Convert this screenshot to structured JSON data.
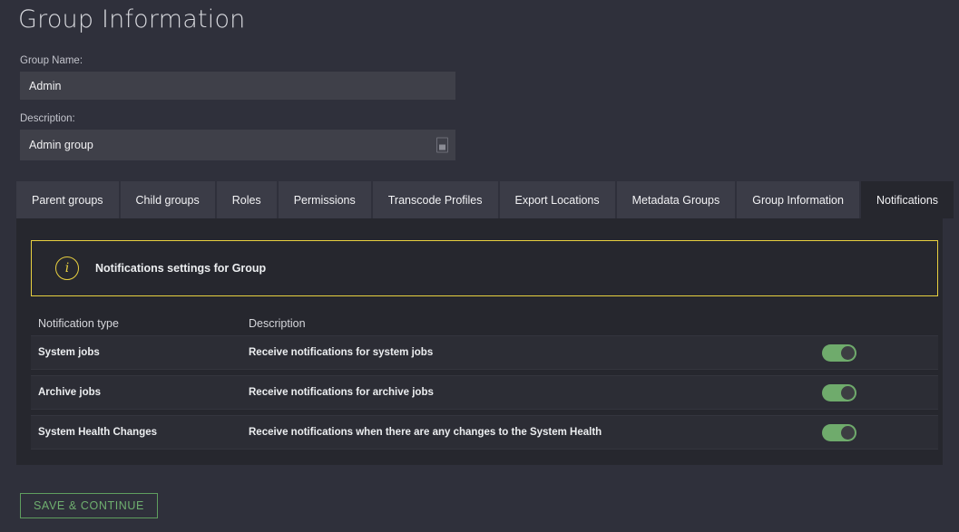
{
  "page": {
    "title": "Group Information"
  },
  "form": {
    "group_name": {
      "label": "Group Name:",
      "value": "Admin",
      "placeholder": ""
    },
    "description": {
      "label": "Description:",
      "value": "Admin group",
      "placeholder": "",
      "grip_icon": "resize-grip-icon"
    }
  },
  "tabs": [
    {
      "label": "Parent groups",
      "active": false
    },
    {
      "label": "Child groups",
      "active": false
    },
    {
      "label": "Roles",
      "active": false
    },
    {
      "label": "Permissions",
      "active": false
    },
    {
      "label": "Transcode Profiles",
      "active": false
    },
    {
      "label": "Export Locations",
      "active": false
    },
    {
      "label": "Metadata Groups",
      "active": false
    },
    {
      "label": "Group Information",
      "active": false
    },
    {
      "label": "Notifications",
      "active": true
    }
  ],
  "banner": {
    "icon": "info-circle-icon",
    "text": "Notifications settings for Group",
    "border_color": "#e8d040"
  },
  "table": {
    "columns": [
      "Notification type",
      "Description",
      ""
    ],
    "rows": [
      {
        "type": "System jobs",
        "description": "Receive notifications for system jobs",
        "enabled": true
      },
      {
        "type": "Archive jobs",
        "description": "Receive notifications for archive jobs",
        "enabled": true
      },
      {
        "type": "System Health Changes",
        "description": "Receive notifications when there are any changes to the System Health",
        "enabled": true
      }
    ]
  },
  "actions": {
    "save_label": "SAVE & CONTINUE"
  },
  "colors": {
    "background": "#2f303b",
    "panel": "#26272e",
    "tab": "#3b3c47",
    "field": "#3f4049",
    "accent_yellow": "#e8d040",
    "accent_green": "#6fab6c",
    "save_green": "#6faf6f"
  }
}
